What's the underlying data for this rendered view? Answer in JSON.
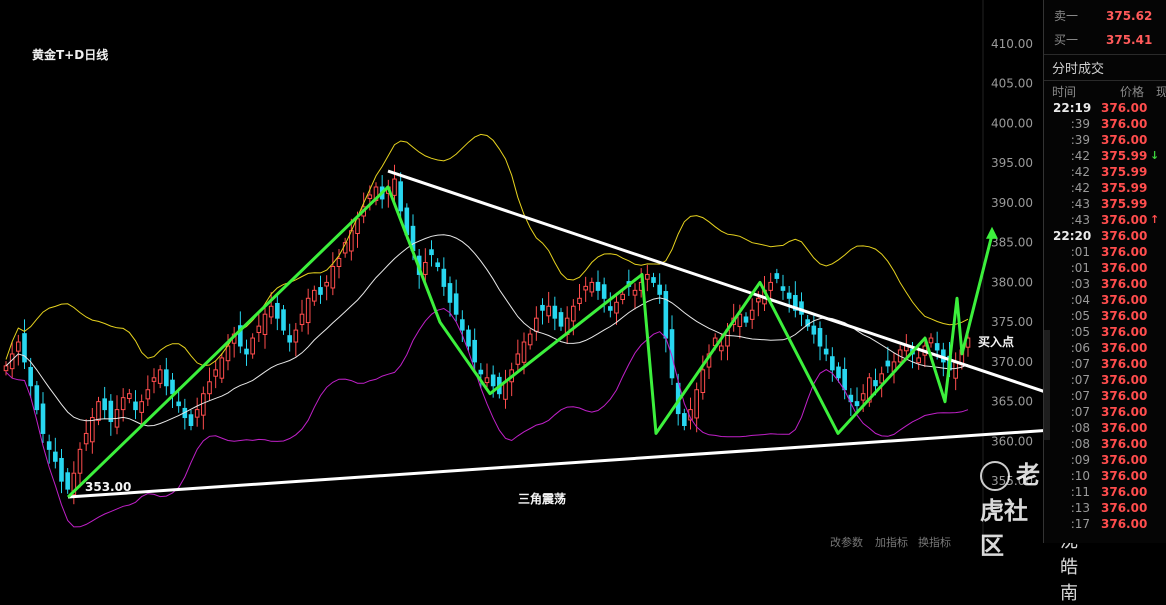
{
  "chart": {
    "title": "黄金T+D日线",
    "annotation_low": "353.00",
    "pattern_label": "三角震荡",
    "buy_label": "买入点"
  },
  "chart_data": {
    "type": "candlestick",
    "title": "黄金T+D日线",
    "ylim": [
      352,
      412
    ],
    "y_ticks": [
      "410.00",
      "405.00",
      "400.00",
      "395.00",
      "390.00",
      "385.00",
      "380.00",
      "375.00",
      "370.00",
      "365.00",
      "360.00",
      "355.00"
    ],
    "annotations": [
      "353.00",
      "三角震荡",
      "买入点"
    ],
    "indicators": [
      "Bollinger upper (yellow)",
      "Bollinger middle (white)",
      "Bollinger lower (magenta)"
    ],
    "closes": [
      369.5,
      371,
      372.5,
      370,
      367,
      364,
      361,
      359,
      357.5,
      355,
      354,
      356,
      359,
      361,
      363,
      365,
      364,
      362.5,
      364,
      365.5,
      366,
      364,
      365,
      366.5,
      368,
      369,
      367,
      366,
      364.5,
      363,
      362,
      364,
      366,
      367.5,
      369,
      370.5,
      372,
      373.5,
      372,
      371,
      373,
      374.5,
      376,
      377,
      375.5,
      374,
      372.5,
      374,
      376,
      378,
      379,
      378.5,
      380,
      382,
      383,
      385,
      386.5,
      388,
      389.5,
      391,
      392,
      390.5,
      392,
      393,
      389,
      386,
      384,
      381,
      382.5,
      383.5,
      382,
      379.5,
      377.5,
      376,
      374,
      372,
      370,
      368.5,
      368,
      367,
      366,
      367.5,
      369,
      371,
      372.5,
      373.5,
      375.5,
      376.5,
      377,
      375.5,
      374.5,
      375.5,
      377,
      378,
      379.5,
      380,
      379,
      378,
      376.5,
      377.5,
      378.5,
      379.5,
      379,
      380,
      381,
      380,
      378.5,
      373,
      368,
      363.5,
      362,
      364,
      366.5,
      369,
      371,
      373,
      372,
      374,
      375.5,
      376,
      375,
      376.5,
      378,
      379,
      380,
      380.5,
      379,
      378,
      376.5,
      376,
      374.5,
      373.5,
      372,
      371,
      369,
      368,
      366.5,
      365,
      364.5,
      366,
      368,
      367,
      368.5,
      369.5,
      370,
      371.5,
      372,
      371,
      370.5,
      372,
      373,
      371.5,
      370,
      369,
      370,
      371.5,
      373
    ],
    "trend_lines": [
      {
        "name": "descending resistance",
        "from": [
          388,
          394
        ],
        "to": [
          1098,
          364
        ]
      },
      {
        "name": "ascending support",
        "from": [
          68,
          353
        ],
        "to": [
          1118,
          362
        ]
      }
    ]
  },
  "scale": {
    "labels": [
      "410.00",
      "405.00",
      "400.00",
      "395.00",
      "390.00",
      "385.00",
      "380.00",
      "375.00",
      "370.00",
      "365.00",
      "360.00",
      "355.00"
    ]
  },
  "watermarks": {
    "community": "老虎社区",
    "author": "@沈皓南",
    "bottom_labels": [
      "改参数",
      "加指标",
      "换指标"
    ]
  },
  "quote": {
    "sell_label": "卖一",
    "sell_price": "375.62",
    "buy_label": "买一",
    "buy_price": "375.41"
  },
  "trades_section": {
    "title": "分时成交",
    "col_time": "时间",
    "col_price": "价格",
    "col_vol": "现"
  },
  "trades": [
    {
      "time": "22:19",
      "price": "376.00",
      "arrow": ""
    },
    {
      "time": ":39",
      "price": "376.00",
      "arrow": ""
    },
    {
      "time": ":39",
      "price": "376.00",
      "arrow": ""
    },
    {
      "time": ":42",
      "price": "375.99",
      "arrow": "↓"
    },
    {
      "time": ":42",
      "price": "375.99",
      "arrow": ""
    },
    {
      "time": ":42",
      "price": "375.99",
      "arrow": ""
    },
    {
      "time": ":43",
      "price": "375.99",
      "arrow": ""
    },
    {
      "time": ":43",
      "price": "376.00",
      "arrow": "↑"
    },
    {
      "time": "22:20",
      "price": "376.00",
      "arrow": ""
    },
    {
      "time": ":01",
      "price": "376.00",
      "arrow": ""
    },
    {
      "time": ":01",
      "price": "376.00",
      "arrow": ""
    },
    {
      "time": ":03",
      "price": "376.00",
      "arrow": ""
    },
    {
      "time": ":04",
      "price": "376.00",
      "arrow": ""
    },
    {
      "time": ":05",
      "price": "376.00",
      "arrow": ""
    },
    {
      "time": ":05",
      "price": "376.00",
      "arrow": ""
    },
    {
      "time": ":06",
      "price": "376.00",
      "arrow": ""
    },
    {
      "time": ":07",
      "price": "376.00",
      "arrow": ""
    },
    {
      "time": ":07",
      "price": "376.00",
      "arrow": ""
    },
    {
      "time": ":07",
      "price": "376.00",
      "arrow": ""
    },
    {
      "time": ":07",
      "price": "376.00",
      "arrow": ""
    },
    {
      "time": ":08",
      "price": "376.00",
      "arrow": ""
    },
    {
      "time": ":08",
      "price": "376.00",
      "arrow": ""
    },
    {
      "time": ":09",
      "price": "376.00",
      "arrow": ""
    },
    {
      "time": ":10",
      "price": "376.00",
      "arrow": ""
    },
    {
      "time": ":11",
      "price": "376.00",
      "arrow": ""
    },
    {
      "time": ":13",
      "price": "376.00",
      "arrow": ""
    },
    {
      "time": ":17",
      "price": "376.00",
      "arrow": ""
    }
  ],
  "colors": {
    "up": "#ff4d4d",
    "down": "#28d7f0",
    "boll_upper": "#e6d21e",
    "boll_mid": "#e8e8e8",
    "boll_lower": "#c020c8",
    "trend_green": "#3cf03c",
    "trend_white": "#ffffff",
    "grid": "#1a1a1a"
  }
}
